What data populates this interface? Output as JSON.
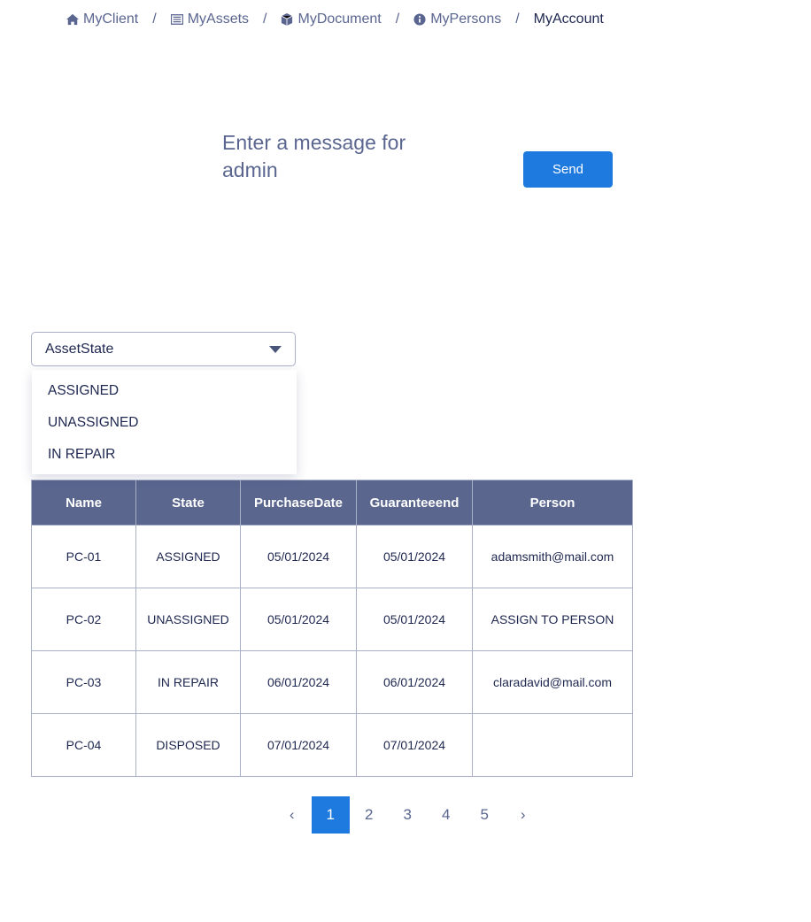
{
  "breadcrumb": [
    {
      "label": "MyClient",
      "icon": "home-icon"
    },
    {
      "label": "MyAssets",
      "icon": "list-icon"
    },
    {
      "label": "MyDocument",
      "icon": "cube-icon"
    },
    {
      "label": "MyPersons",
      "icon": "info-icon"
    },
    {
      "label": "MyAccount",
      "icon": null
    }
  ],
  "separator": "/",
  "message": {
    "placeholder": "Enter a message for admin",
    "send_label": "Send"
  },
  "filter": {
    "selected": "AssetState",
    "options": [
      "ASSIGNED",
      "UNASSIGNED",
      "IN REPAIR"
    ]
  },
  "table": {
    "headers": [
      "Name",
      "State",
      "PurchaseDate",
      "Guaranteeend",
      "Person"
    ],
    "rows": [
      [
        "PC-01",
        "ASSIGNED",
        "05/01/2024",
        "05/01/2024",
        "adamsmith@mail.com"
      ],
      [
        "PC-02",
        "UNASSIGNED",
        "05/01/2024",
        "05/01/2024",
        "ASSIGN TO PERSON"
      ],
      [
        "PC-03",
        "IN REPAIR",
        "06/01/2024",
        "06/01/2024",
        "claradavid@mail.com"
      ],
      [
        "PC-04",
        "DISPOSED",
        "07/01/2024",
        "07/01/2024",
        ""
      ]
    ]
  },
  "pagination": {
    "prev": "‹",
    "next": "›",
    "pages": [
      "1",
      "2",
      "3",
      "4",
      "5"
    ],
    "current": "1"
  },
  "colors": {
    "accent": "#1f7ae0",
    "header": "#5a668e"
  }
}
